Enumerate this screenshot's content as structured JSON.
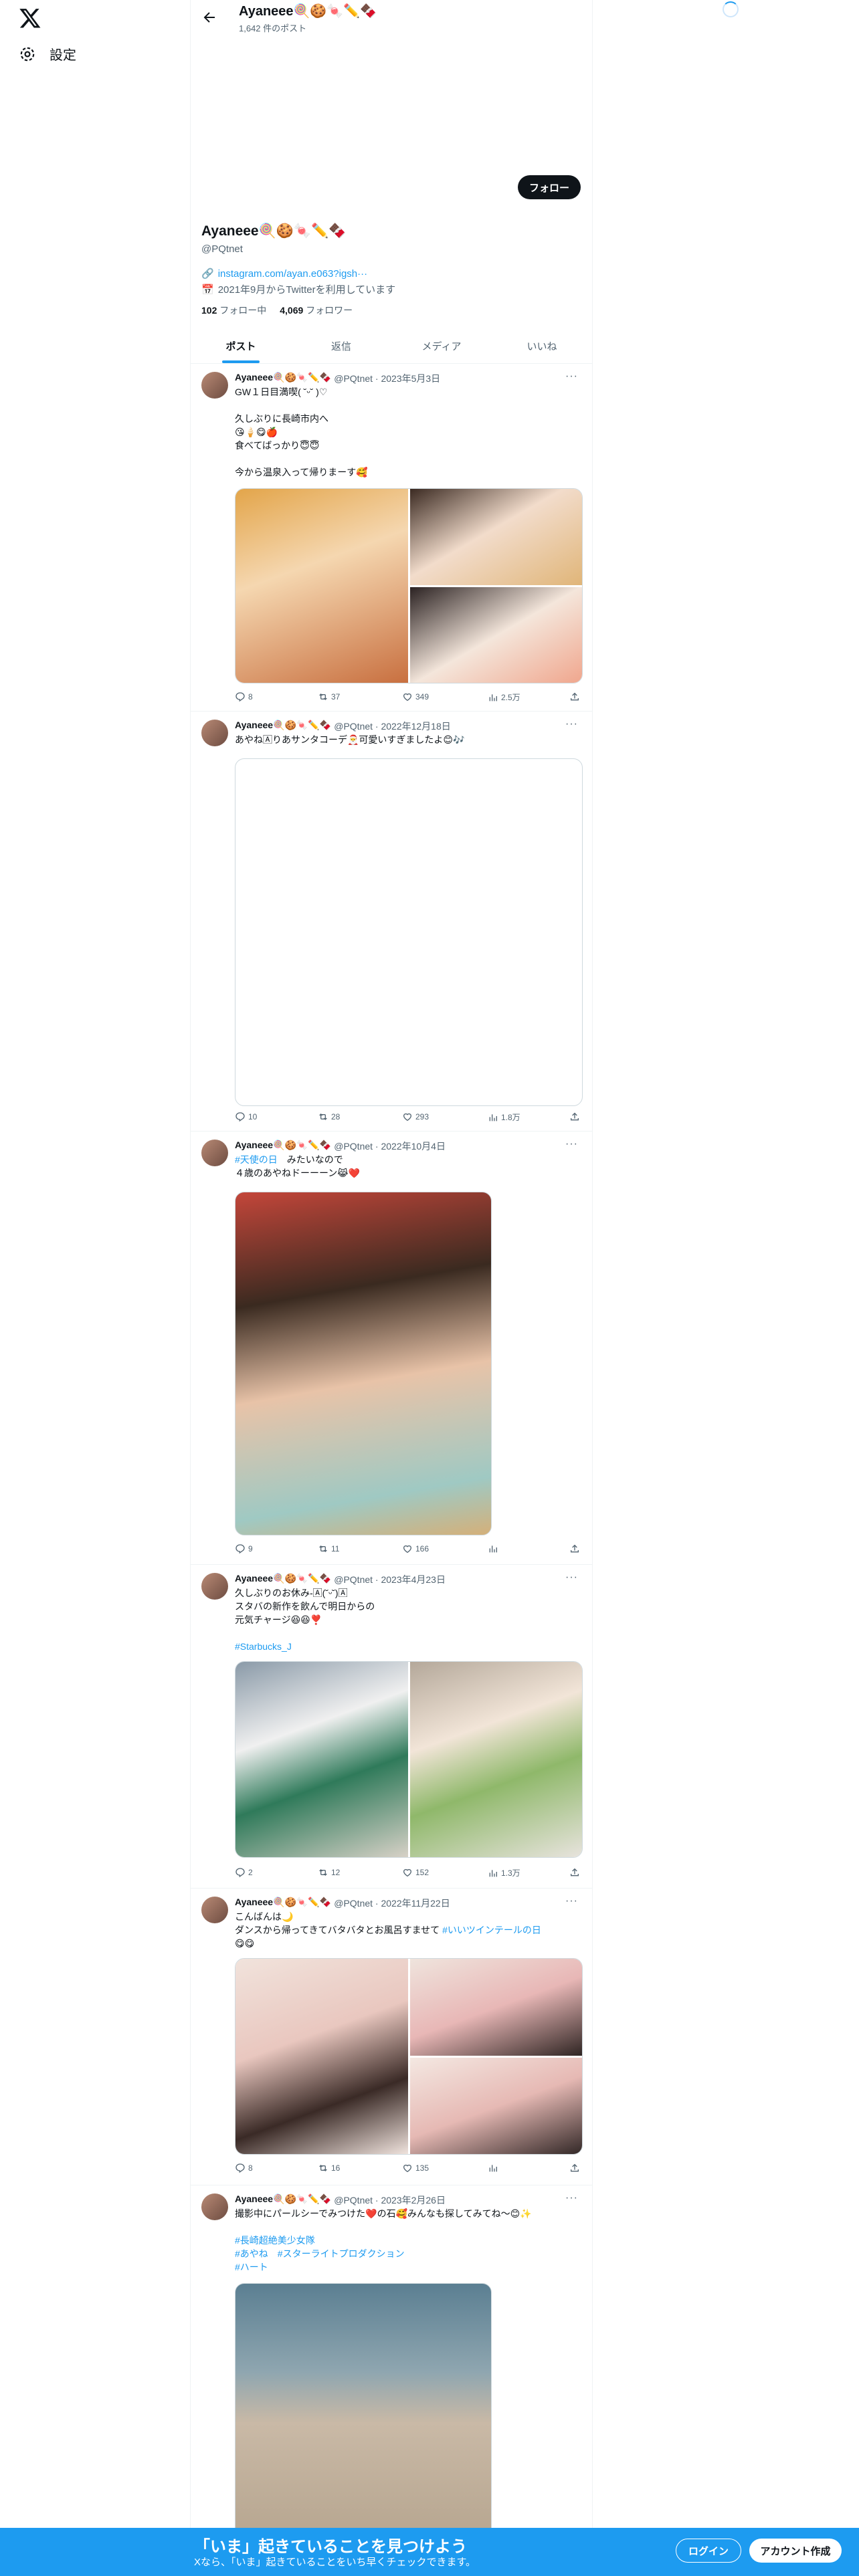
{
  "header": {
    "name": "Ayaneee🍭🍪🍬✏️🍫",
    "post_count": "1,642 件のポスト"
  },
  "nav": {
    "settings": "設定"
  },
  "profile": {
    "follow_label": "フォロー",
    "name": "Ayaneee🍭🍪🍬✏️🍫",
    "handle": "@PQtnet",
    "link": "instagram.com/ayan.e063?igsh···",
    "joined": "2021年9月からTwitterを利用しています",
    "following_count": "102",
    "following_label": "フォロー中",
    "followers_count": "4,069",
    "followers_label": "フォロワー"
  },
  "tabs": [
    "ポスト",
    "返信",
    "メディア",
    "いいね"
  ],
  "tweets": [
    {
      "name": "Ayaneee🍭🍪🍬✏️🍫",
      "meta": "@PQtnet · 2023年5月3日",
      "text": "GW１日目満喫( ˘ᵕ˘ )♡\n\n久しぶりに長崎市内へ\n😘🍦😋🍎\n食べてばっかり😇😇\n\n今から温泉入って帰りまーす🥰",
      "reply": "8",
      "retweet": "37",
      "like": "349",
      "views": "2.5万"
    },
    {
      "name": "Ayaneee🍭🍪🍬✏️🍫",
      "meta": "@PQtnet · 2022年12月18日",
      "text": "あやね🄰りあサンタコーデ🎅可愛いすぎましたよ😊🎶",
      "reply": "10",
      "retweet": "28",
      "like": "293",
      "views": "1.8万"
    },
    {
      "name": "Ayaneee🍭🍪🍬✏️🍫",
      "meta": "@PQtnet · 2022年10月4日",
      "tag": "#天使の日",
      "text": "　みたいなので\n４歳のあやねドーーーン😹❤️",
      "reply": "9",
      "retweet": "11",
      "like": "166",
      "views": ""
    },
    {
      "name": "Ayaneee🍭🍪🍬✏️🍫",
      "meta": "@PQtnet · 2023年4月23日",
      "text": "久しぶりのお休み-🄰(˘ᵕ˘)🄰\nスタバの新作を飲んで明日からの\n元気チャージ😆😆❣️",
      "tag": "#Starbucks_J",
      "reply": "2",
      "retweet": "12",
      "like": "152",
      "views": "1.3万"
    },
    {
      "name": "Ayaneee🍭🍪🍬✏️🍫",
      "meta": "@PQtnet · 2022年11月22日",
      "text": "こんばんは🌙\nダンスから帰ってきてバタバタとお風呂すませて",
      "tag": "#いいツインテールの日",
      "text2": "😋😋",
      "reply": "8",
      "retweet": "16",
      "like": "135",
      "views": ""
    },
    {
      "name": "Ayaneee🍭🍪🍬✏️🍫",
      "meta": "@PQtnet · 2023年2月26日",
      "text": "撮影中にパールシーでみつけた❤️の石🥰みんなも探してみてね〜😊✨",
      "tags": [
        "#長崎超絶美少女隊",
        "#あやね",
        "#スターライトプロダクション",
        "#ハート"
      ]
    }
  ],
  "banner": {
    "title": "「いま」起きていることを見つけよう",
    "subtitle": "Xなら、「いま」起きていることをいち早くチェックできます。",
    "login": "ログイン",
    "signup": "アカウント作成"
  },
  "colors": {
    "accent": "#1d9bf0",
    "text": "#0f1419",
    "muted": "#536471"
  }
}
